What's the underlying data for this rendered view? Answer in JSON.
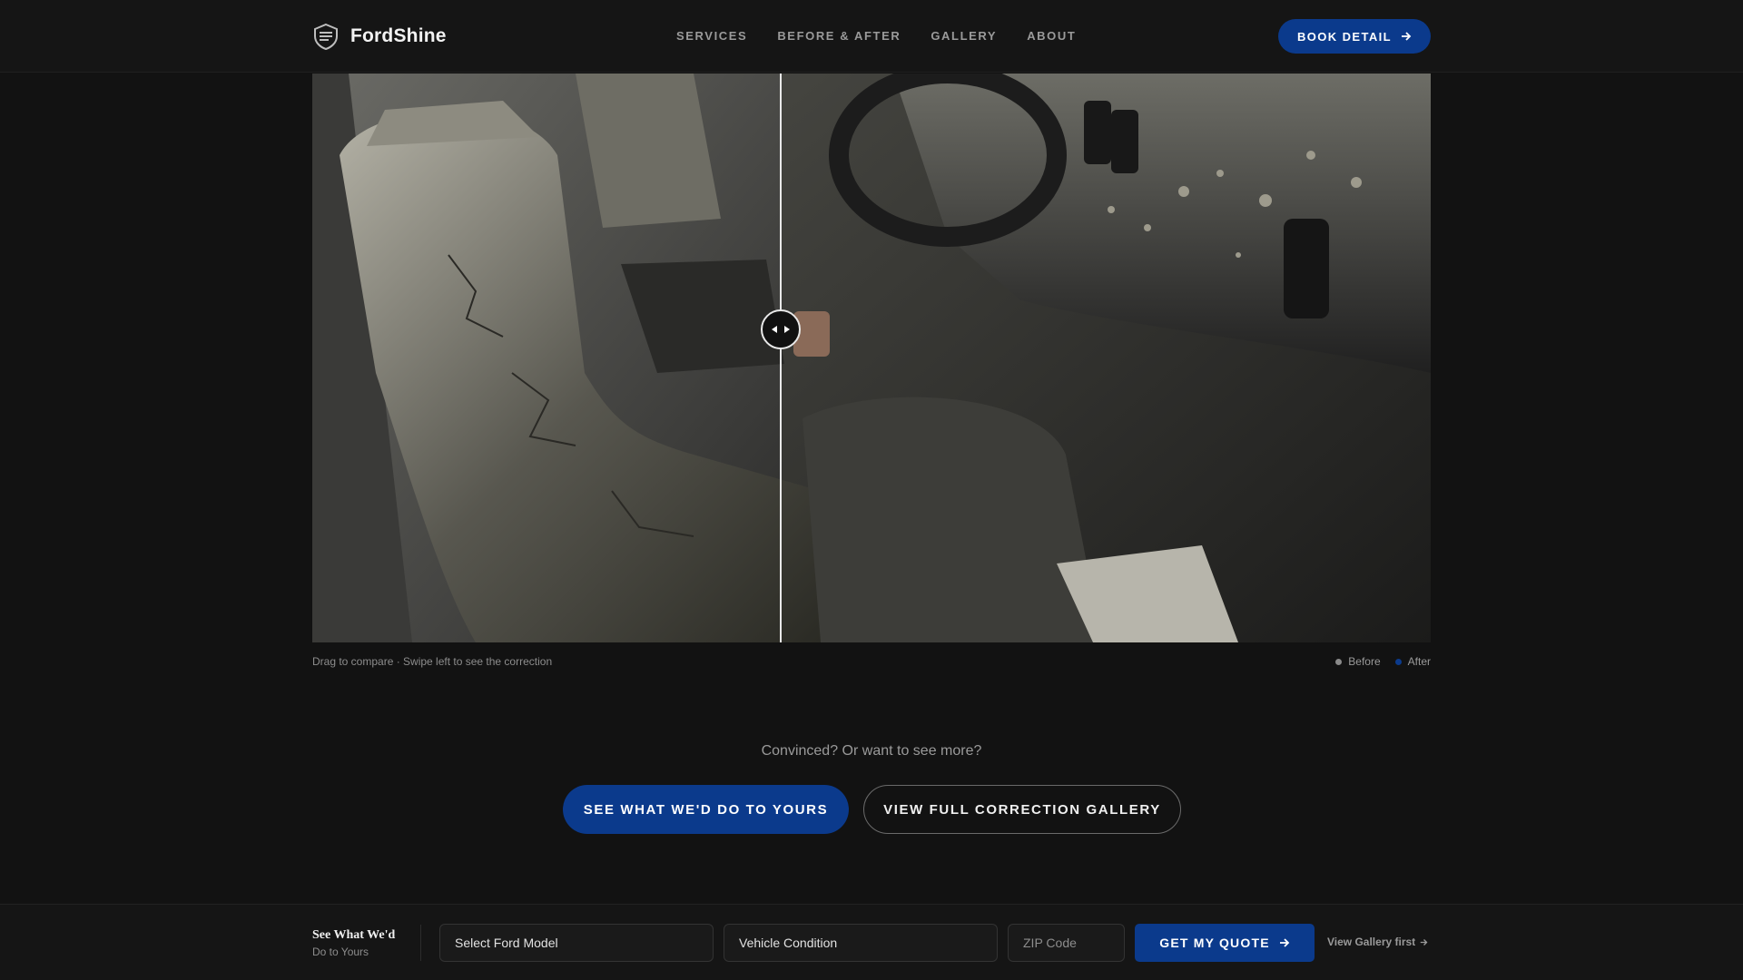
{
  "brand": {
    "name": "FordShine",
    "logo_icon": "shield-logo-icon"
  },
  "nav": [
    {
      "label": "SERVICES"
    },
    {
      "label": "BEFORE & AFTER"
    },
    {
      "label": "GALLERY"
    },
    {
      "label": "ABOUT"
    }
  ],
  "header": {
    "book_label": "BOOK DETAIL"
  },
  "compare": {
    "before_image": "car-interior-before-photo",
    "after_image": "car-interior-after-photo",
    "split_position": 0.42,
    "caption": "Drag to compare · Swipe left to see the correction",
    "legend": [
      {
        "label": "Before",
        "color": "#8a8a8a"
      },
      {
        "label": "After",
        "color": "#0b3a8c"
      }
    ]
  },
  "cta": {
    "question": "Convinced? Or want to see more?",
    "primary_label": "SEE WHAT WE'D DO TO YOURS",
    "secondary_label": "VIEW FULL CORRECTION GALLERY"
  },
  "quote_bar": {
    "title": "See What We'd",
    "subtitle": "Do to Yours",
    "model_value": "Select Ford Model",
    "condition_value": "Vehicle Condition",
    "zip_placeholder": "ZIP Code",
    "submit_label": "GET MY QUOTE",
    "gallery_link": "View Gallery first"
  },
  "colors": {
    "accent": "#0b3a8c",
    "background": "#121212"
  }
}
